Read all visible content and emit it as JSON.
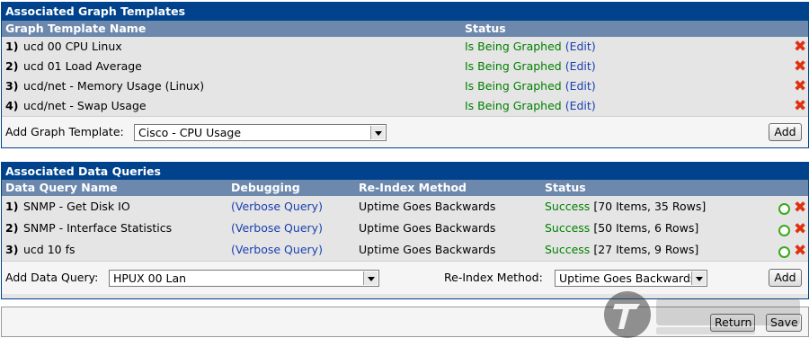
{
  "graph_templates": {
    "title": "Associated Graph Templates",
    "col_name": "Graph Template Name",
    "col_status": "Status",
    "rows": [
      {
        "num": "1)",
        "name": "ucd 00 CPU Linux",
        "status": "Is Being Graphed",
        "edit": "Edit"
      },
      {
        "num": "2)",
        "name": "ucd 01 Load Average",
        "status": "Is Being Graphed",
        "edit": "Edit"
      },
      {
        "num": "3)",
        "name": "ucd/net - Memory Usage (Linux)",
        "status": "Is Being Graphed",
        "edit": "Edit"
      },
      {
        "num": "4)",
        "name": "ucd/net - Swap Usage",
        "status": "Is Being Graphed",
        "edit": "Edit"
      }
    ],
    "add_label": "Add Graph Template:",
    "add_selected": "Cisco - CPU Usage",
    "add_button": "Add"
  },
  "data_queries": {
    "title": "Associated Data Queries",
    "col_name": "Data Query Name",
    "col_debug": "Debugging",
    "col_reindex": "Re-Index Method",
    "col_status": "Status",
    "rows": [
      {
        "num": "1)",
        "name": "SNMP - Get Disk IO",
        "debug": "Verbose Query",
        "reindex": "Uptime Goes Backwards",
        "status": "Success",
        "detail": "[70 Items, 35 Rows]"
      },
      {
        "num": "2)",
        "name": "SNMP - Interface Statistics",
        "debug": "Verbose Query",
        "reindex": "Uptime Goes Backwards",
        "status": "Success",
        "detail": "[50 Items, 6 Rows]"
      },
      {
        "num": "3)",
        "name": "ucd 10 fs",
        "debug": "Verbose Query",
        "reindex": "Uptime Goes Backwards",
        "status": "Success",
        "detail": "[27 Items, 9 Rows]"
      }
    ],
    "add_label": "Add Data Query:",
    "add_selected": "HPUX 00 Lan",
    "reindex_label": "Re-Index Method:",
    "reindex_selected": "Uptime Goes Backwards",
    "add_button": "Add"
  },
  "footer": {
    "return_button": "Return",
    "save_button": "Save"
  },
  "colors": {
    "header_bg": "#00438C",
    "subheader_bg": "#6D88AD",
    "status_green": "#008000",
    "link_blue": "#1A3FB0",
    "delete_red": "#E03010",
    "reload_green": "#3CA81E"
  }
}
